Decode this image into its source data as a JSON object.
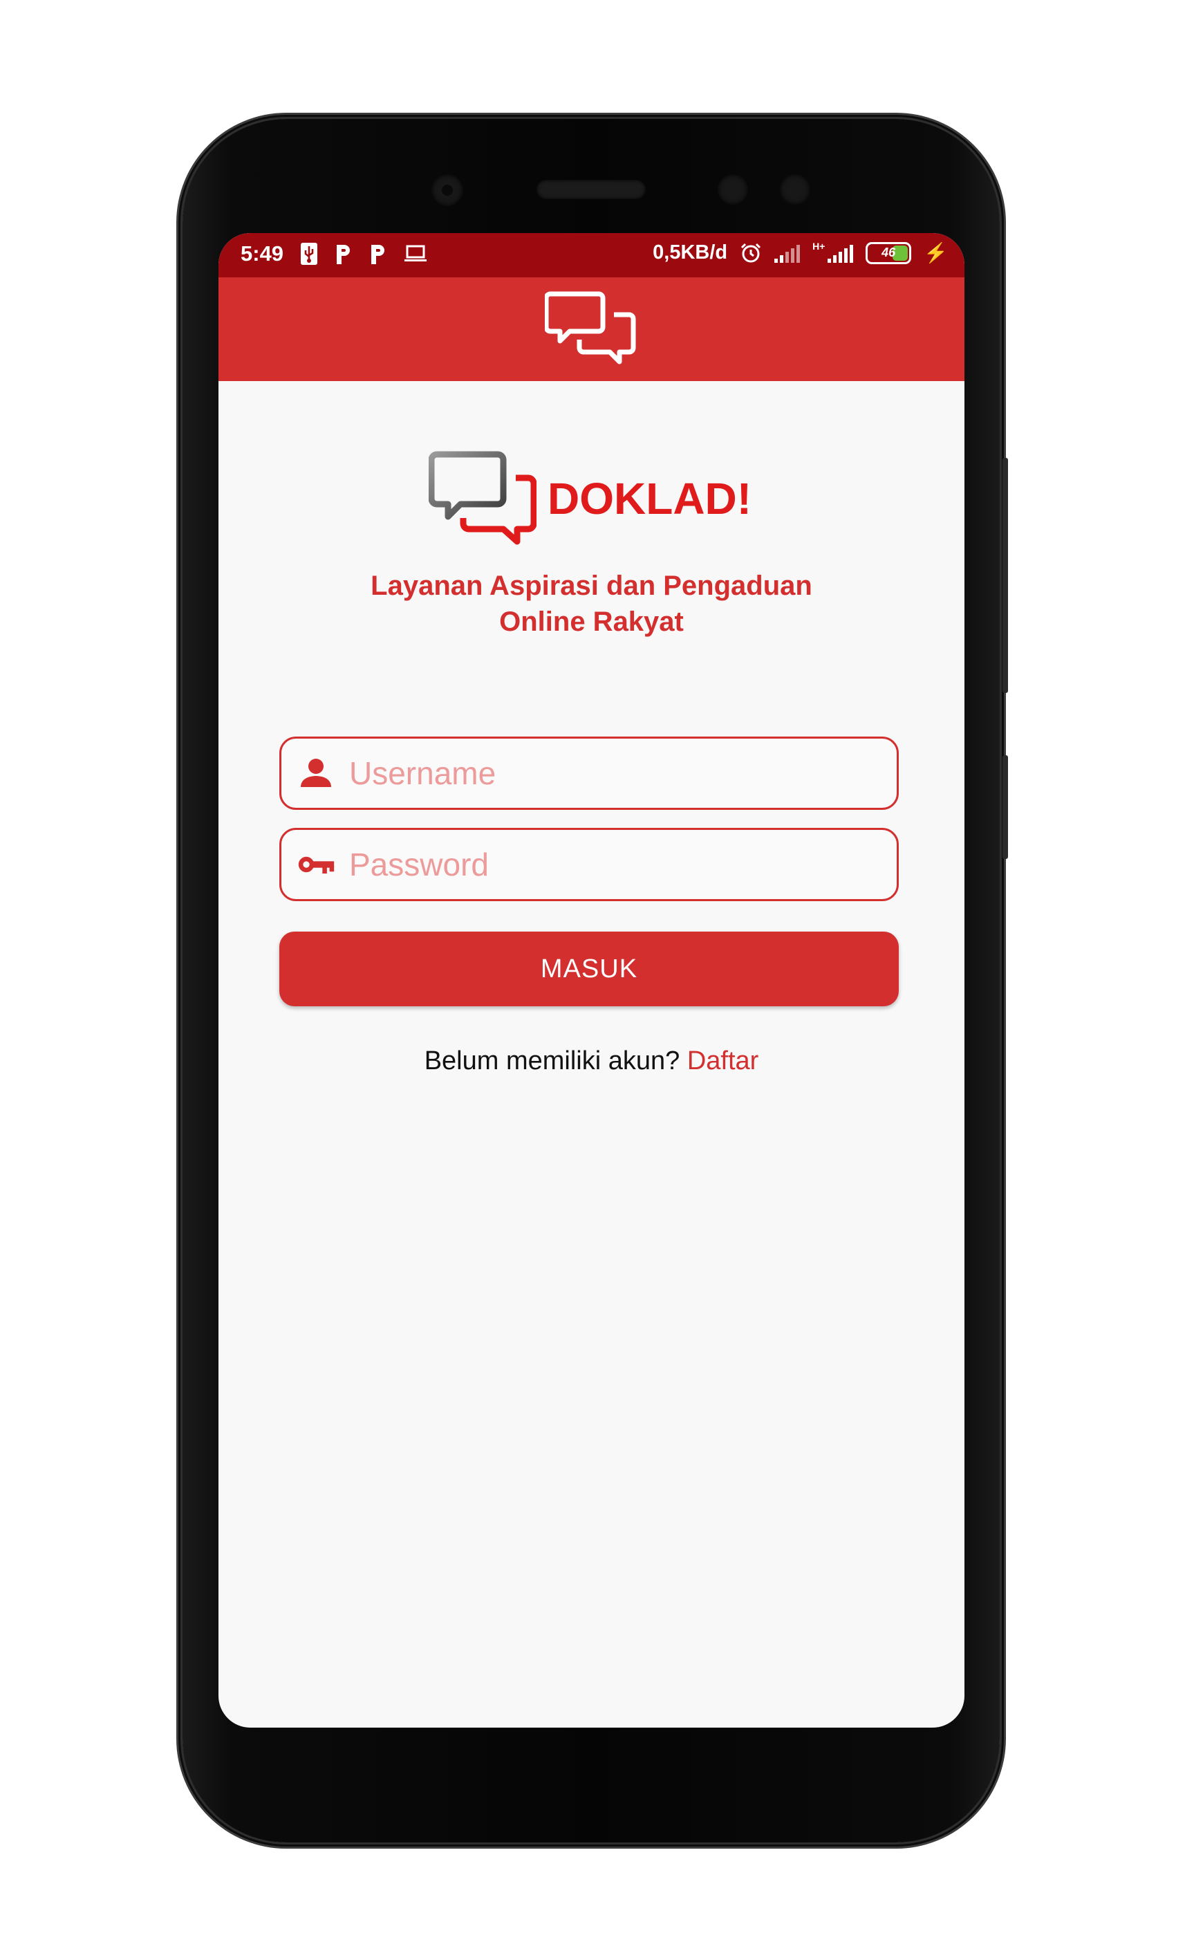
{
  "status_bar": {
    "time": "5:49",
    "left_icons": [
      "usb-icon",
      "parking-icon",
      "parking-icon",
      "laptop-icon"
    ],
    "net_speed": "0,5KB/d",
    "network_type": "H+",
    "battery_level": "46",
    "battery_color": "#6dc23a"
  },
  "app_bar": {
    "icon": "chat-bubbles-icon",
    "color": "#d32f2f"
  },
  "brand": {
    "name": "DOKLAD!",
    "tagline_line1": "Layanan Aspirasi dan Pengaduan",
    "tagline_line2": "Online Rakyat"
  },
  "form": {
    "username_placeholder": "Username",
    "username_value": "",
    "password_placeholder": "Password",
    "password_value": "",
    "submit_label": "MASUK"
  },
  "signup": {
    "prompt": "Belum memiliki akun?",
    "link_label": "Daftar"
  },
  "colors": {
    "accent": "#d32f2f",
    "status_bar": "#9c0a0f",
    "brand_red": "#e01b1b"
  }
}
